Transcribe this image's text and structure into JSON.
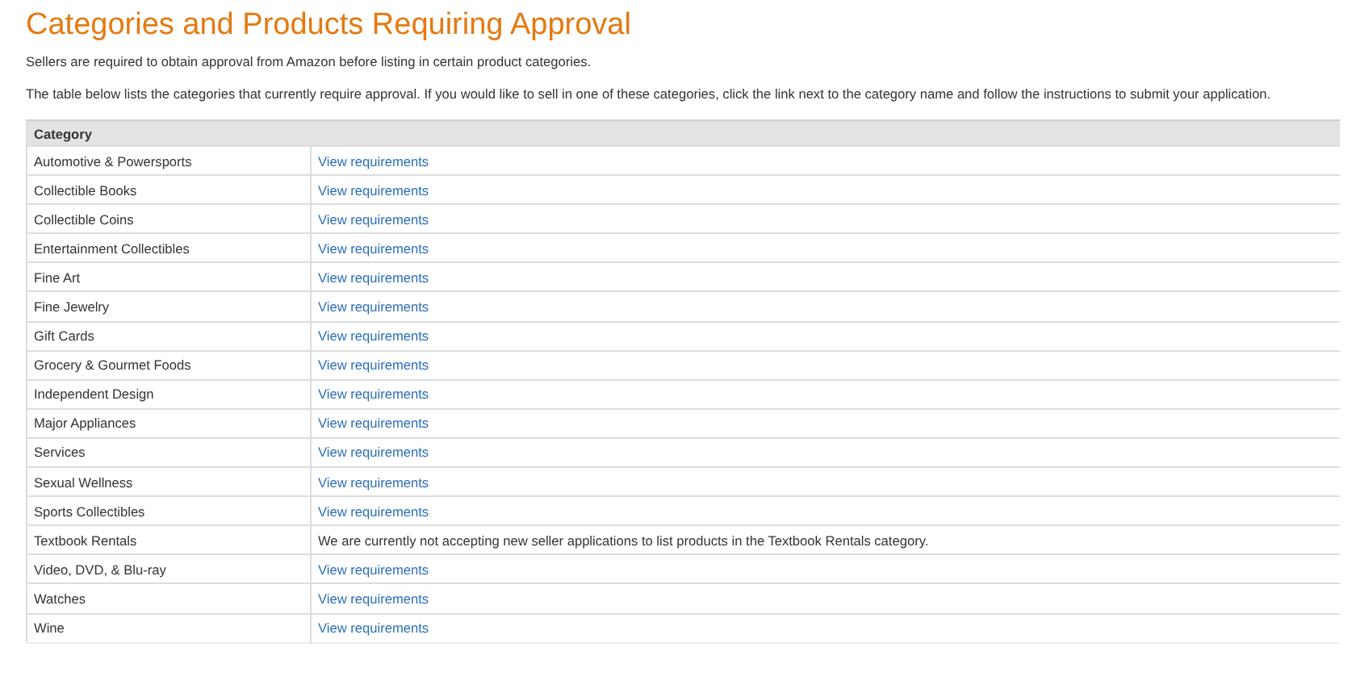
{
  "title": "Categories and Products Requiring Approval",
  "intro": [
    "Sellers are required to obtain approval from Amazon before listing in certain product categories.",
    "The table below lists the categories that currently require approval. If you would like to sell in one of these categories, click the link next to the category name and follow the instructions to submit your application."
  ],
  "table": {
    "columns": [
      "Category"
    ],
    "rows": [
      {
        "category": "Automotive & Powersports",
        "kind": "link",
        "detail": "View requirements"
      },
      {
        "category": "Collectible Books",
        "kind": "link",
        "detail": "View requirements"
      },
      {
        "category": "Collectible Coins",
        "kind": "link",
        "detail": "View requirements"
      },
      {
        "category": "Entertainment Collectibles",
        "kind": "link",
        "detail": "View requirements"
      },
      {
        "category": "Fine Art",
        "kind": "link",
        "detail": "View requirements"
      },
      {
        "category": "Fine Jewelry",
        "kind": "link",
        "detail": "View requirements"
      },
      {
        "category": "Gift Cards",
        "kind": "link",
        "detail": "View requirements"
      },
      {
        "category": "Grocery & Gourmet Foods",
        "kind": "link",
        "detail": "View requirements"
      },
      {
        "category": "Independent Design",
        "kind": "link",
        "detail": "View requirements"
      },
      {
        "category": "Major Appliances",
        "kind": "link",
        "detail": "View requirements"
      },
      {
        "category": "Services",
        "kind": "link",
        "detail": "View requirements"
      },
      {
        "category": "Sexual Wellness",
        "kind": "link",
        "detail": "View requirements"
      },
      {
        "category": "Sports Collectibles",
        "kind": "link",
        "detail": "View requirements"
      },
      {
        "category": "Textbook Rentals",
        "kind": "text",
        "detail": "We are currently not accepting new seller applications to list products in the Textbook Rentals category."
      },
      {
        "category": "Video, DVD, & Blu-ray",
        "kind": "link",
        "detail": "View requirements"
      },
      {
        "category": "Watches",
        "kind": "link",
        "detail": "View requirements"
      },
      {
        "category": "Wine",
        "kind": "link",
        "detail": "View requirements"
      }
    ]
  }
}
